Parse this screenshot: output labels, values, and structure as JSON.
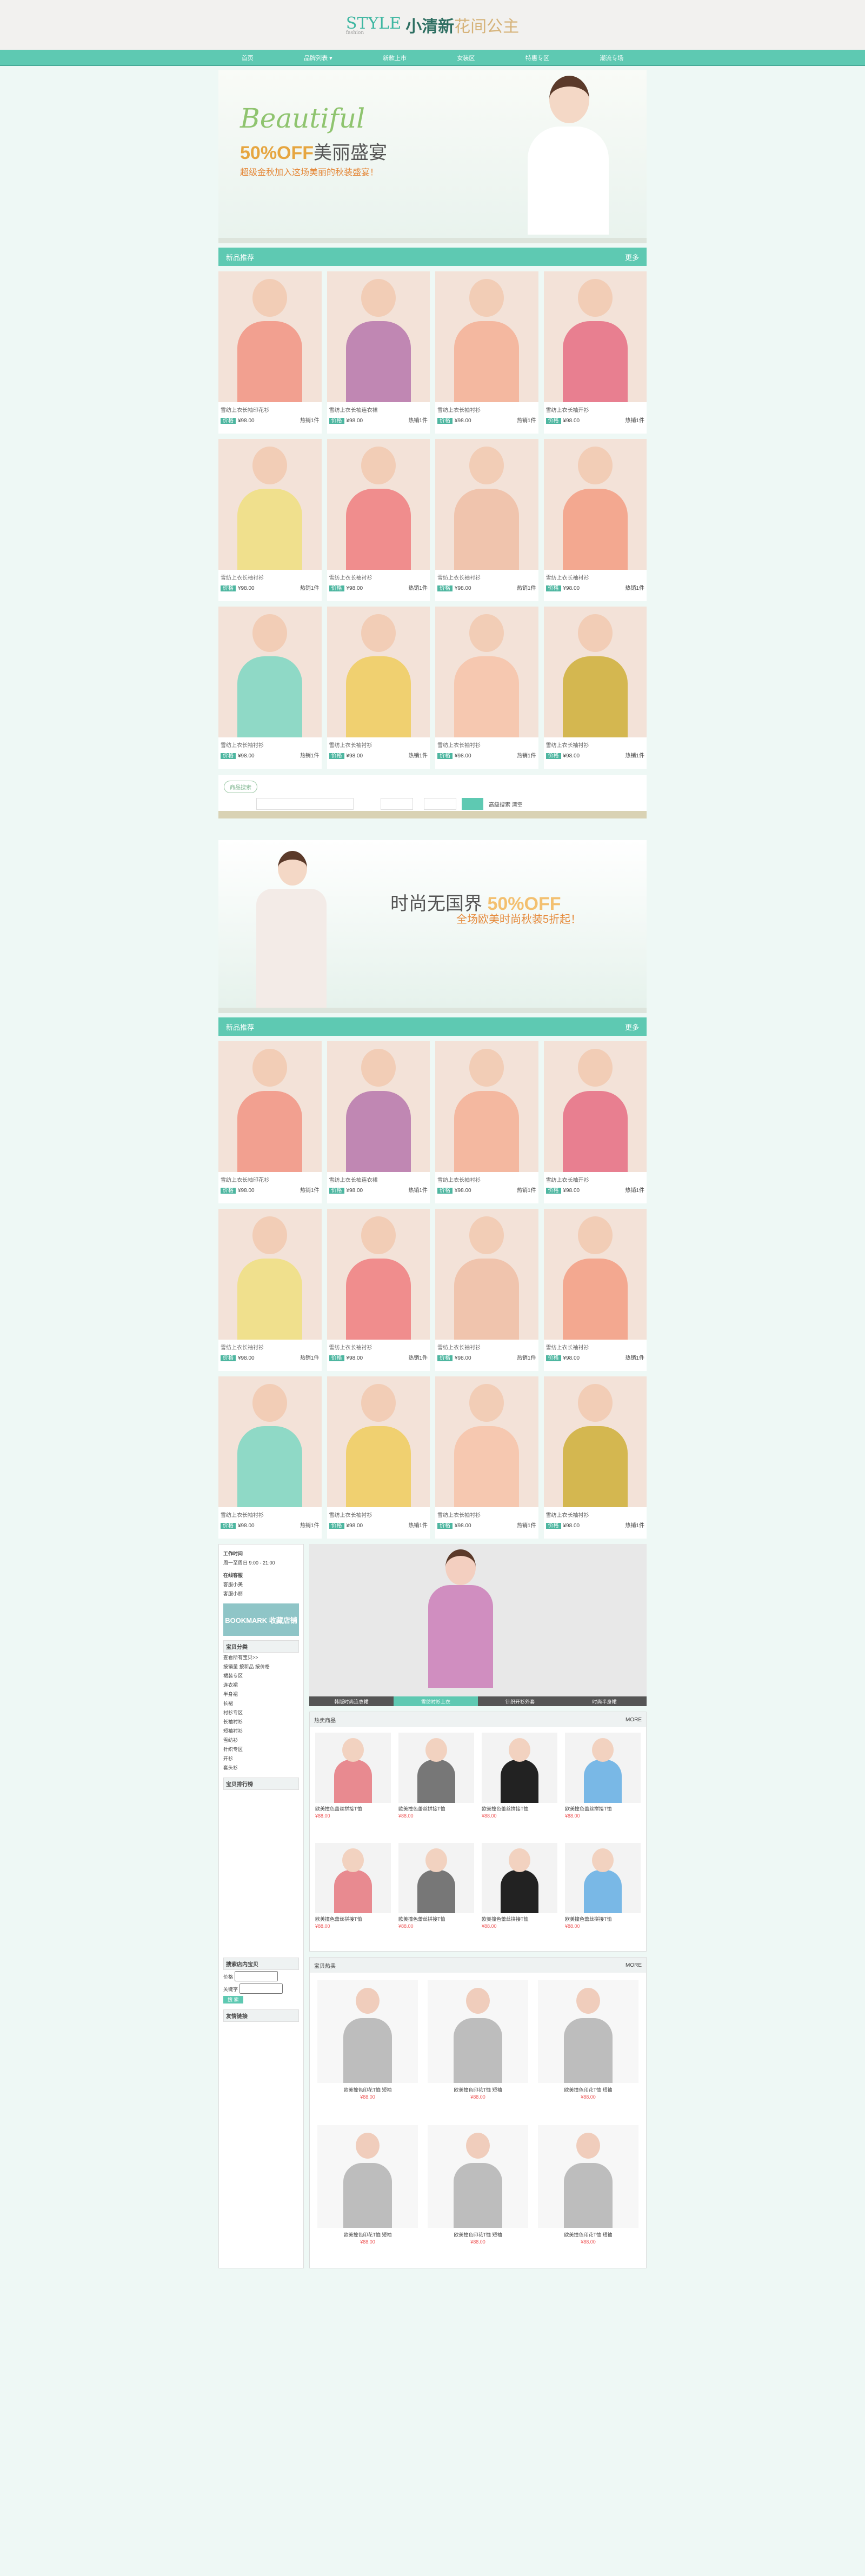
{
  "logo": {
    "mark": "STYLE",
    "mark_sub": "fashion",
    "brand": "小清新",
    "brand_suffix": "花间公主"
  },
  "nav": [
    "首页",
    "品牌列表 ▾",
    "新款上市",
    "女装区",
    "特惠专区",
    "潮流专场"
  ],
  "banner": {
    "big": "Beautiful",
    "mid_accent": "50%OFF",
    "mid": "美丽盛宴",
    "sub": "超级金秋加入这场美丽的秋装盛宴！"
  },
  "section1": {
    "title": "新品推荐",
    "more": "更多"
  },
  "products": [
    {
      "name": "雪纺上衣长袖印花衫",
      "price": "¥98.00",
      "sold": "热销1件",
      "color": "#f2a090"
    },
    {
      "name": "雪纺上衣长袖连衣裙",
      "price": "¥98.00",
      "sold": "热销1件",
      "color": "#c087b3"
    },
    {
      "name": "雪纺上衣长袖衬衫",
      "price": "¥98.00",
      "sold": "热销1件",
      "color": "#f4b8a0"
    },
    {
      "name": "雪纺上衣长袖开衫",
      "price": "¥98.00",
      "sold": "热销1件",
      "color": "#e87f90"
    },
    {
      "name": "雪纺上衣长袖衬衫",
      "price": "¥98.00",
      "sold": "热销1件",
      "color": "#f0e08d"
    },
    {
      "name": "雪纺上衣长袖衬衫",
      "price": "¥98.00",
      "sold": "热销1件",
      "color": "#f08d8d"
    },
    {
      "name": "雪纺上衣长袖衬衫",
      "price": "¥98.00",
      "sold": "热销1件",
      "color": "#f0c4ad"
    },
    {
      "name": "雪纺上衣长袖衬衫",
      "price": "¥98.00",
      "sold": "热销1件",
      "color": "#f3a890"
    },
    {
      "name": "雪纺上衣长袖衬衫",
      "price": "¥98.00",
      "sold": "热销1件",
      "color": "#8fd9c6"
    },
    {
      "name": "雪纺上衣长袖衬衫",
      "price": "¥98.00",
      "sold": "热销1件",
      "color": "#f0d070"
    },
    {
      "name": "雪纺上衣长袖衬衫",
      "price": "¥98.00",
      "sold": "热销1件",
      "color": "#f6c8b0"
    },
    {
      "name": "雪纺上衣长袖衬衫",
      "price": "¥98.00",
      "sold": "热销1件",
      "color": "#d4b750"
    }
  ],
  "search": {
    "label": "商品搜索",
    "text": "高级搜索   清空"
  },
  "banner2": {
    "t1": "时尚无国界",
    "t1_accent": "50%OFF",
    "t2": "全场欧美时尚秋装5折起！"
  },
  "section2": {
    "title": "新品推荐",
    "more": "更多"
  },
  "side": {
    "hours_title": "工作时间",
    "hours": "周一至周日 9:00 - 21:00",
    "service_title": "在线客服",
    "service1": "客服小美",
    "service2": "客服小丽",
    "bookmark": "BOOKMARK 收藏店铺",
    "cat_title": "宝贝分类",
    "cat": [
      "查看所有宝贝>>",
      "按销量  按新品  按价格",
      "裙装专区",
      "连衣裙",
      "半身裙",
      "长裙",
      "衬衫专区",
      "长袖衬衫",
      "短袖衬衫",
      "雪纺衫",
      "针织专区",
      "开衫",
      "套头衫"
    ],
    "rank_title": "宝贝排行榜",
    "search_title": "搜索店内宝贝",
    "price_label": "价格",
    "kw_label": "关键字",
    "go": "搜 索",
    "link_title": "友情链接"
  },
  "feature_tabs": [
    "韩版时尚连衣裙",
    "雪纺衬衫上衣",
    "针织开衫外套",
    "时尚半身裙"
  ],
  "panel1": {
    "title": "热卖商品",
    "more": "MORE"
  },
  "panel1_items": [
    {
      "name": "欧美撞色蕾丝拼接T恤",
      "price": "¥88.00",
      "color": "#e88a90"
    },
    {
      "name": "欧美撞色蕾丝拼接T恤",
      "price": "¥88.00",
      "color": "#777"
    },
    {
      "name": "欧美撞色蕾丝拼接T恤",
      "price": "¥88.00",
      "color": "#222"
    },
    {
      "name": "欧美撞色蕾丝拼接T恤",
      "price": "¥88.00",
      "color": "#79b8e6"
    },
    {
      "name": "欧美撞色蕾丝拼接T恤",
      "price": "¥88.00",
      "color": "#e88a90"
    },
    {
      "name": "欧美撞色蕾丝拼接T恤",
      "price": "¥88.00",
      "color": "#777"
    },
    {
      "name": "欧美撞色蕾丝拼接T恤",
      "price": "¥88.00",
      "color": "#222"
    },
    {
      "name": "欧美撞色蕾丝拼接T恤",
      "price": "¥88.00",
      "color": "#79b8e6"
    }
  ],
  "panel2": {
    "title": "宝贝热卖",
    "more": "MORE"
  },
  "panel2_items": [
    {
      "name": "欧美撞色印花T恤 短袖",
      "price": "¥88.00"
    },
    {
      "name": "欧美撞色印花T恤 短袖",
      "price": "¥88.00"
    },
    {
      "name": "欧美撞色印花T恤 短袖",
      "price": "¥88.00"
    },
    {
      "name": "欧美撞色印花T恤 短袖",
      "price": "¥88.00"
    },
    {
      "name": "欧美撞色印花T恤 短袖",
      "price": "¥88.00"
    },
    {
      "name": "欧美撞色印花T恤 短袖",
      "price": "¥88.00"
    }
  ]
}
